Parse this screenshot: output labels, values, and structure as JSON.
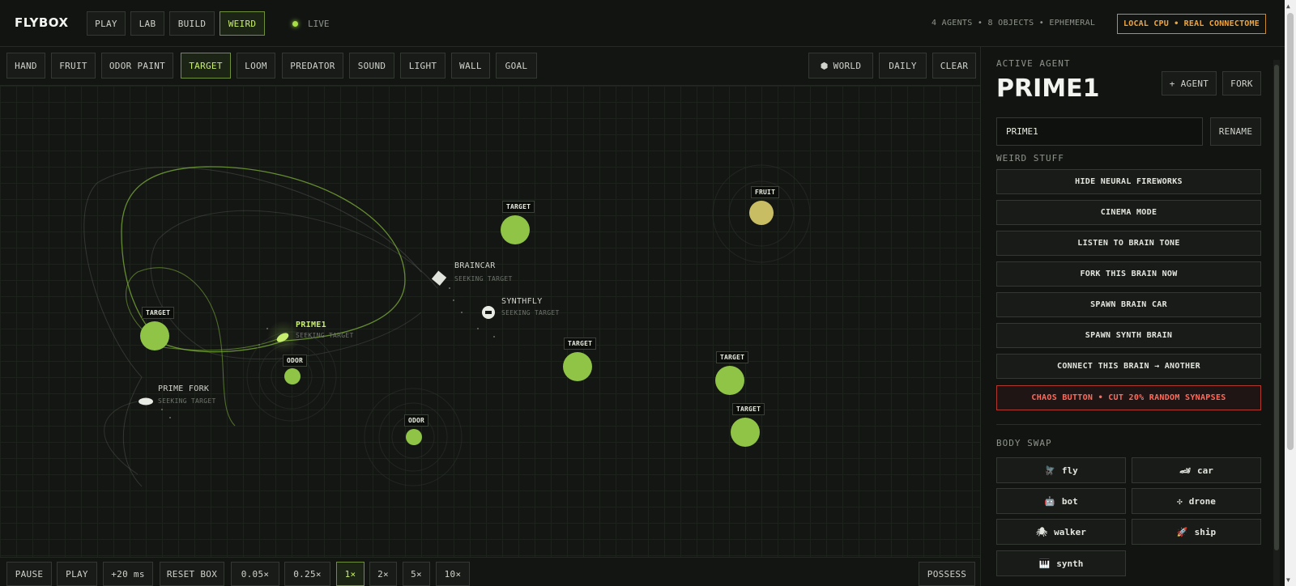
{
  "app": {
    "logo": "FLYBOX",
    "live": "LIVE",
    "status": "4 AGENTS • 8 OBJECTS • EPHEMERAL",
    "cpu_badge": "LOCAL CPU • REAL CONNECTOME"
  },
  "nav": {
    "tabs": [
      "PLAY",
      "LAB",
      "BUILD",
      "WEIRD"
    ],
    "active": "WEIRD"
  },
  "tools": {
    "items": [
      "HAND",
      "FRUIT",
      "ODOR PAINT",
      "TARGET",
      "LOOM",
      "PREDATOR",
      "SOUND",
      "LIGHT",
      "WALL",
      "GOAL"
    ],
    "active": "TARGET",
    "world": "WORLD",
    "daily": "DAILY",
    "clear": "CLEAR"
  },
  "arena": {
    "target_label": "TARGET",
    "fruit_label": "FRUIT",
    "odor_label": "ODOR",
    "agents": [
      {
        "name": "PRIME1",
        "state": "SEEKING TARGET"
      },
      {
        "name": "BRAINCAR",
        "state": "SEEKING TARGET"
      },
      {
        "name": "SYNTHFLY",
        "state": "SEEKING TARGET"
      },
      {
        "name": "PRIME FORK",
        "state": "SEEKING TARGET"
      }
    ]
  },
  "controls": {
    "pause": "PAUSE",
    "play": "PLAY",
    "step": "+20 ms",
    "reset": "RESET BOX",
    "speeds": [
      "0.05×",
      "0.25×",
      "1×",
      "2×",
      "5×",
      "10×"
    ],
    "active_speed": "1×",
    "possess": "POSSESS"
  },
  "panel": {
    "active_agent_label": "ACTIVE AGENT",
    "agent_name": "PRIME1",
    "add_agent": "+ AGENT",
    "fork": "FORK",
    "name_value": "PRIME1",
    "rename": "RENAME",
    "weird_label": "WEIRD STUFF",
    "weird_actions": [
      "HIDE NEURAL FIREWORKS",
      "CINEMA MODE",
      "LISTEN TO BRAIN TONE",
      "FORK THIS BRAIN NOW",
      "SPAWN BRAIN CAR",
      "SPAWN SYNTH BRAIN",
      "CONNECT THIS BRAIN → ANOTHER",
      "CHAOS BUTTON • CUT 20% RANDOM SYNAPSES"
    ],
    "body_swap_label": "BODY SWAP",
    "bodies": [
      {
        "label": "fly",
        "icon": "🪰"
      },
      {
        "label": "car",
        "icon": "🏎"
      },
      {
        "label": "bot",
        "icon": "🤖"
      },
      {
        "label": "drone",
        "icon": "✣"
      },
      {
        "label": "walker",
        "icon": "🕷"
      },
      {
        "label": "ship",
        "icon": "🚀"
      },
      {
        "label": "synth",
        "icon": "🎹"
      }
    ]
  },
  "colors": {
    "accent": "#a6e045",
    "target": "#8fc446",
    "fruit": "#c8bd62",
    "warning": "#f0a53a",
    "danger": "#ff6a5a"
  }
}
